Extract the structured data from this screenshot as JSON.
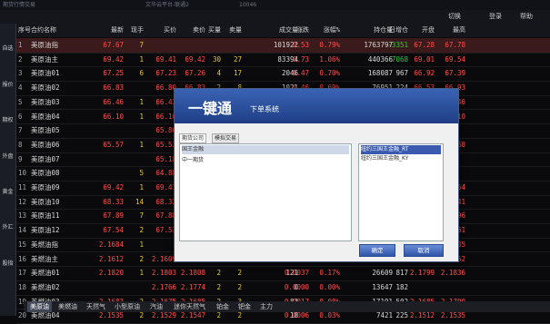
{
  "window": {
    "title_left": "期货行情交易",
    "title_mid": "文华云平台-联通2",
    "title_right": "10046"
  },
  "toolbar": {
    "items": [
      "切换",
      "登录",
      "帮助"
    ]
  },
  "sidebar": {
    "items": [
      "自选",
      "报价",
      "期权",
      "外盘",
      "黄金",
      "外汇",
      "股指"
    ]
  },
  "columns": [
    "序号",
    "合约名称",
    "最新",
    "现手",
    "买价",
    "卖价",
    "买量",
    "卖量",
    "成交量",
    "涨跌",
    "涨幅%",
    "持仓量",
    "日增仓",
    "开盘",
    "最高"
  ],
  "rows": [
    [
      "1",
      "美原油指",
      "67.67",
      "7",
      "",
      "",
      "",
      "",
      "101922",
      "0.53",
      "0.79%",
      "1763797",
      "-3351",
      "67.28",
      "67.78"
    ],
    [
      "2",
      "美原油主",
      "69.42",
      "1",
      "69.41",
      "69.42",
      "30",
      "27",
      "83394",
      "0.73",
      "1.06%",
      "440366",
      "-7068",
      "69.01",
      "69.54"
    ],
    [
      "3",
      "美原油01",
      "67.25",
      "6",
      "67.23",
      "67.26",
      "4",
      "17",
      "2046",
      "0.47",
      "0.70%",
      "168087",
      "967",
      "66.92",
      "67.39"
    ],
    [
      "4",
      "美原油02",
      "66.83",
      "",
      "66.80",
      "66.83",
      "2",
      "8",
      "1021",
      "0.46",
      "0.69%",
      "76951",
      "224",
      "66.53",
      "66.93"
    ],
    [
      "5",
      "美原油03",
      "66.46",
      "1",
      "66.43",
      "",
      "",
      "",
      "",
      "",
      "",
      "",
      "",
      "66.46",
      "66.46"
    ],
    [
      "6",
      "美原油04",
      "66.10",
      "1",
      "66.10",
      "",
      "",
      "",
      "",
      "",
      "",
      "",
      "",
      "66.06",
      "66.10"
    ],
    [
      "7",
      "美原油05",
      "",
      "",
      "65.80",
      "",
      "",
      "",
      "",
      "",
      "",
      "",
      "",
      "",
      ""
    ],
    [
      "8",
      "美原油06",
      "65.57",
      "1",
      "65.53",
      "",
      "",
      "",
      "",
      "",
      "",
      "",
      "",
      "65.27",
      "65.68"
    ],
    [
      "9",
      "美原油07",
      "",
      "",
      "65.18",
      "",
      "",
      "",
      "",
      "",
      "",
      "",
      "",
      "",
      ""
    ],
    [
      "10",
      "美原油08",
      "",
      "5",
      "64.88",
      "",
      "",
      "",
      "",
      "",
      "",
      "",
      "",
      "",
      ""
    ],
    [
      "11",
      "美原油09",
      "69.42",
      "1",
      "69.41",
      "",
      "",
      "",
      "",
      "",
      "",
      "",
      "",
      "69.01",
      "69.54"
    ],
    [
      "12",
      "美原油10",
      "68.33",
      "14",
      "68.32",
      "",
      "",
      "",
      "",
      "",
      "",
      "",
      "",
      "67.97",
      "68.41"
    ],
    [
      "13",
      "美原油11",
      "67.89",
      "7",
      "67.88",
      "",
      "",
      "",
      "",
      "",
      "",
      "",
      "",
      "67.53",
      "67.96"
    ],
    [
      "14",
      "美原油12",
      "67.54",
      "2",
      "67.53",
      "",
      "",
      "",
      "",
      "",
      "",
      "",
      "",
      "67.16",
      "67.61"
    ],
    [
      "15",
      "美燃油指",
      "2.1684",
      "1",
      "",
      "",
      "",
      "",
      "",
      "",
      "",
      "",
      "",
      "2.1655",
      "2.1735"
    ],
    [
      "16",
      "美燃油主",
      "2.1612",
      "2",
      "2.1609",
      "",
      "",
      "",
      "",
      "",
      "",
      "",
      "",
      "2.1603",
      "2.1652"
    ],
    [
      "17",
      "美燃油01",
      "2.1820",
      "1",
      "2.1803",
      "2.1808",
      "2",
      "2",
      "121",
      "0.0037",
      "0.17%",
      "26609",
      "817",
      "2.1799",
      "2.1836"
    ],
    [
      "18",
      "美燃油02",
      "",
      "",
      "2.1766",
      "2.1774",
      "2",
      "2",
      "0",
      "0.0000",
      "0.00%",
      "13647",
      "182",
      "",
      ""
    ],
    [
      "19",
      "美燃油03",
      "2.1683",
      "2",
      "2.1675",
      "2.1685",
      "2",
      "3",
      "83",
      "0.0017",
      "0.08%",
      "17191",
      "502",
      "2.1685",
      "2.1700"
    ],
    [
      "20",
      "美燃油04",
      "2.1535",
      "2",
      "2.1529",
      "2.1547",
      "2",
      "2",
      "18",
      "0.0006",
      "0.03%",
      "7421",
      "225",
      "2.1512",
      "2.1535"
    ]
  ],
  "bottom_tabs": [
    "美原油",
    "美燃油",
    "天然气",
    "小型原油",
    "汽油",
    "迷你天然气",
    "铂金",
    "钯金",
    "主力"
  ],
  "dialog": {
    "title": "一键通",
    "subtitle": "下单系统",
    "tabs": [
      "期货公司",
      "模拟交易"
    ],
    "left_items": [
      "国王金融",
      "中一期货"
    ],
    "right_items": [
      "纽约三国王金融_RT",
      "纽约三国王金融_KY"
    ],
    "confirm_label": "确定",
    "cancel_label": "取消"
  },
  "colors": {
    "up": "#ff4d4d",
    "down": "#2ecc40",
    "dialog_header": "#2a4e9c"
  }
}
